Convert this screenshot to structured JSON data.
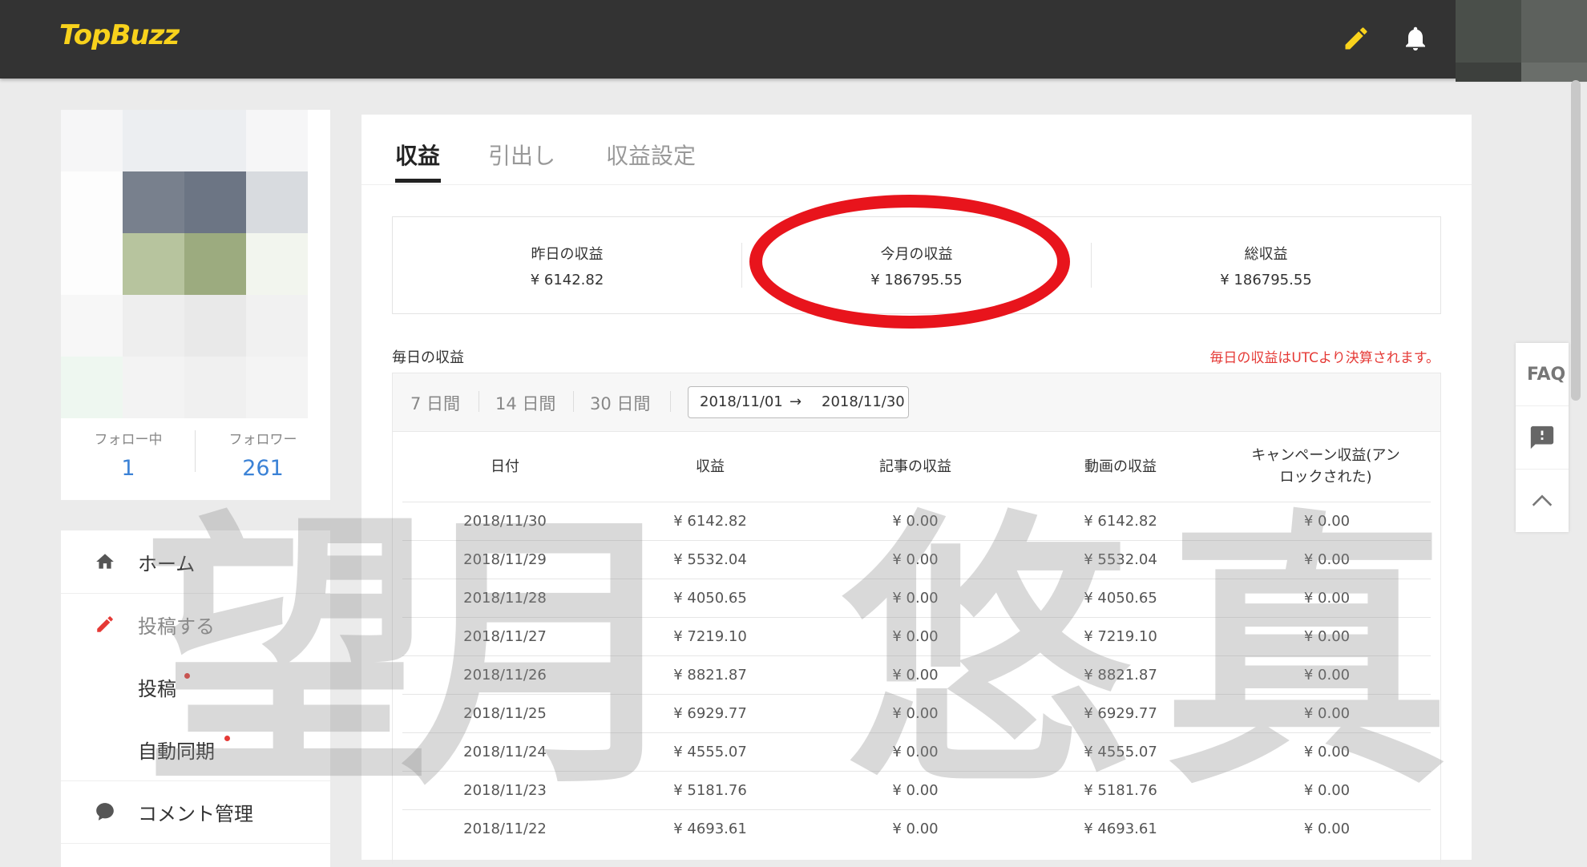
{
  "header": {
    "logo": "TopBuzz",
    "edit_icon": "pencil-icon",
    "notification_icon": "bell-icon",
    "accent_color": "#f8d21c"
  },
  "profile": {
    "following_label": "フォロー中",
    "following_count": "1",
    "followers_label": "フォロワー",
    "followers_count": "261"
  },
  "nav": {
    "home": "ホーム",
    "post": "投稿する",
    "post_sub": "投稿",
    "auto_sync": "自動同期",
    "comments": "コメント管理"
  },
  "tabs": [
    "収益",
    "引出し",
    "収益設定"
  ],
  "summary": {
    "yesterday_label": "昨日の収益",
    "yesterday_value": "¥ 6142.82",
    "month_label": "今月の収益",
    "month_value": "¥ 186795.55",
    "total_label": "総収益",
    "total_value": "¥ 186795.55"
  },
  "daily": {
    "title": "毎日の収益",
    "note": "毎日の収益はUTCより決算されます。",
    "ranges": [
      "7 日間",
      "14 日間",
      "30 日間"
    ],
    "date_from": "2018/11/01",
    "date_arrow": "→",
    "date_to": "2018/11/30"
  },
  "table": {
    "headers": [
      "日付",
      "収益",
      "記事の収益",
      "動画の収益",
      "キャンペーン収益(アンロックされた)"
    ],
    "rows": [
      [
        "2018/11/30",
        "¥ 6142.82",
        "¥ 0.00",
        "¥ 6142.82",
        "¥ 0.00"
      ],
      [
        "2018/11/29",
        "¥ 5532.04",
        "¥ 0.00",
        "¥ 5532.04",
        "¥ 0.00"
      ],
      [
        "2018/11/28",
        "¥ 4050.65",
        "¥ 0.00",
        "¥ 4050.65",
        "¥ 0.00"
      ],
      [
        "2018/11/27",
        "¥ 7219.10",
        "¥ 0.00",
        "¥ 7219.10",
        "¥ 0.00"
      ],
      [
        "2018/11/26",
        "¥ 8821.87",
        "¥ 0.00",
        "¥ 8821.87",
        "¥ 0.00"
      ],
      [
        "2018/11/25",
        "¥ 6929.77",
        "¥ 0.00",
        "¥ 6929.77",
        "¥ 0.00"
      ],
      [
        "2018/11/24",
        "¥ 4555.07",
        "¥ 0.00",
        "¥ 4555.07",
        "¥ 0.00"
      ],
      [
        "2018/11/23",
        "¥ 5181.76",
        "¥ 0.00",
        "¥ 5181.76",
        "¥ 0.00"
      ],
      [
        "2018/11/22",
        "¥ 4693.61",
        "¥ 0.00",
        "¥ 4693.61",
        "¥ 0.00"
      ]
    ]
  },
  "watermark": [
    "望",
    "月",
    "悠",
    "真"
  ],
  "float": {
    "faq": "FAQ",
    "feedback_icon": "feedback-icon",
    "top_icon": "chevron-up-icon"
  }
}
